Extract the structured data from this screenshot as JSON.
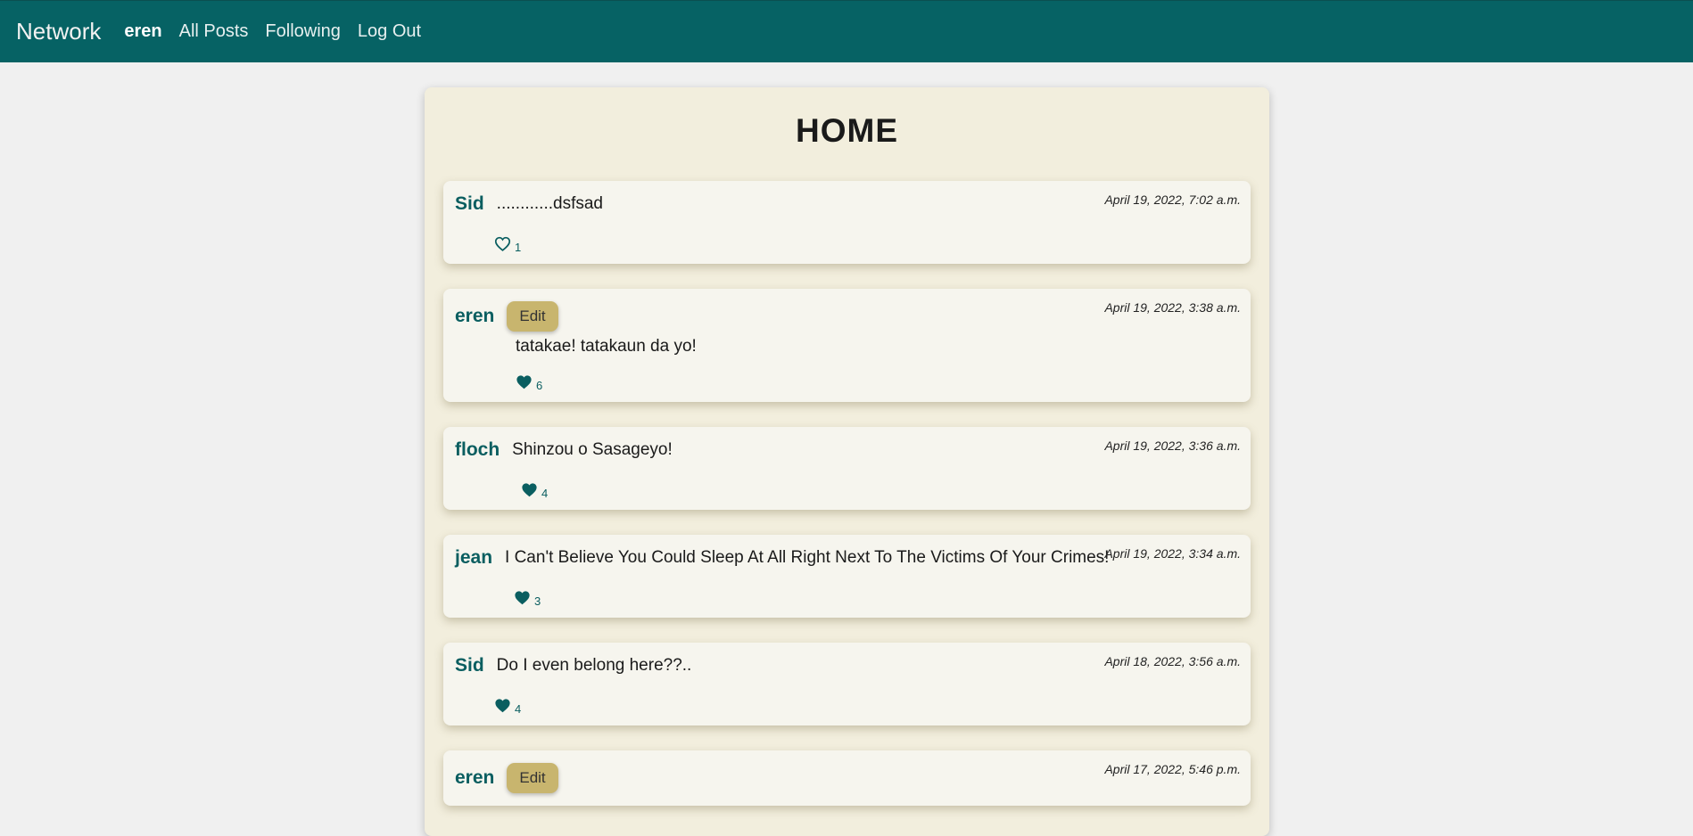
{
  "nav": {
    "brand": "Network",
    "user": "eren",
    "links": [
      "All Posts",
      "Following",
      "Log Out"
    ]
  },
  "page": {
    "title": "HOME"
  },
  "colors": {
    "nav_bg": "#066264",
    "accent": "#0a5e60",
    "edit_button": "#c8b56e",
    "card_bg": "#f2eedd"
  },
  "posts": [
    {
      "author": "Sid",
      "content": "............dsfsad",
      "timestamp": "April 19, 2022, 7:02 a.m.",
      "likes": "1",
      "liked": false,
      "editable": false
    },
    {
      "author": "eren",
      "content": "tatakae! tatakaun da yo!",
      "timestamp": "April 19, 2022, 3:38 a.m.",
      "likes": "6",
      "liked": true,
      "editable": true,
      "edit_label": "Edit"
    },
    {
      "author": "floch",
      "content": "Shinzou o Sasageyo!",
      "timestamp": "April 19, 2022, 3:36 a.m.",
      "likes": "4",
      "liked": true,
      "editable": false
    },
    {
      "author": "jean",
      "content": "I Can't Believe You Could Sleep At All Right Next To The Victims Of Your Crimes!",
      "timestamp": "April 19, 2022, 3:34 a.m.",
      "likes": "3",
      "liked": true,
      "editable": false
    },
    {
      "author": "Sid",
      "content": "Do I even belong here??..",
      "timestamp": "April 18, 2022, 3:56 a.m.",
      "likes": "4",
      "liked": true,
      "editable": false
    },
    {
      "author": "eren",
      "content": "",
      "timestamp": "April 17, 2022, 5:46 p.m.",
      "likes": "",
      "liked": true,
      "editable": true,
      "edit_label": "Edit"
    }
  ]
}
